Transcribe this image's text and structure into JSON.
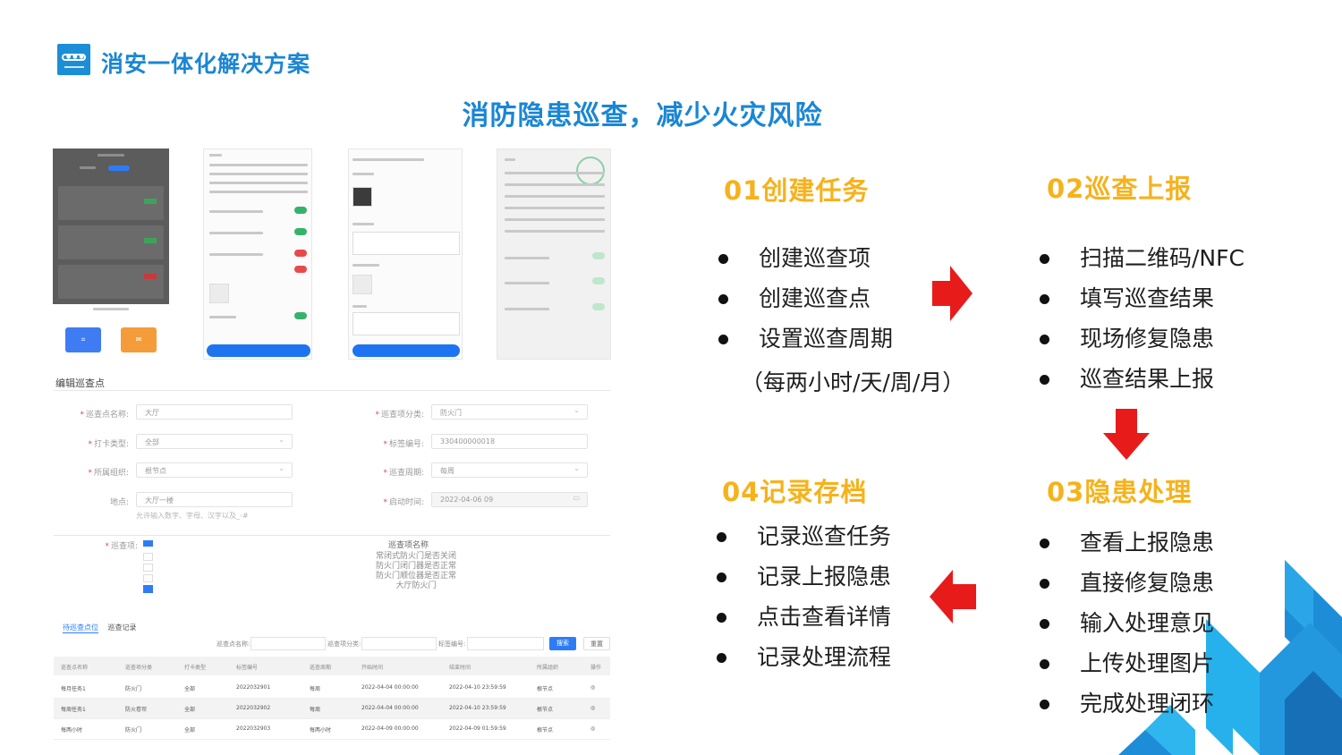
{
  "header": {
    "brand": "消安一体化解决方案",
    "headline": "消防隐患巡查，减少火灾风险"
  },
  "form": {
    "title": "编辑巡查点",
    "fields": [
      {
        "label": "巡查点名称:",
        "value": "大厅"
      },
      {
        "label": "巡查项分类:",
        "value": "防火门"
      },
      {
        "label": "打卡类型:",
        "value": "全部"
      },
      {
        "label": "标签编号:",
        "value": "330400000018"
      },
      {
        "label": "所属组织:",
        "value": "根节点"
      },
      {
        "label": "巡查周期:",
        "value": "每周"
      },
      {
        "label": "地点:",
        "value": "大厅一楼"
      },
      {
        "label": "启动时间:",
        "value": "2022-04-06 09"
      }
    ],
    "hint": "允许输入数字、字母、汉字以及_-#",
    "items_label": "巡查项:",
    "items_header": "巡查项名称",
    "items": [
      "常闭式防火门是否关闭",
      "防火门闭门器是否正常",
      "防火门顺位器是否正常",
      "大厅防火门"
    ]
  },
  "table": {
    "tabs": [
      "待巡查点位",
      "巡查记录"
    ],
    "search_labels": [
      "巡查点名称:",
      "巡查项分类:",
      "标签编号:"
    ],
    "search_button": "搜索",
    "reset_button": "重置",
    "columns": [
      "巡查点名称",
      "巡查项分类",
      "打卡类型",
      "标签编号",
      "巡查周期",
      "开始时间",
      "结束时间",
      "所属组织",
      "操作"
    ],
    "rows": [
      [
        "每月任务1",
        "防火门",
        "全部",
        "2022032901",
        "每周",
        "2022-04-04 00:00:00",
        "2022-04-10 23:59:59",
        "根节点",
        "◎"
      ],
      [
        "每周任务1",
        "防火卷帘",
        "全部",
        "2022032902",
        "每周",
        "2022-04-04 00:00:00",
        "2022-04-10 23:59:59",
        "根节点",
        "◎"
      ],
      [
        "每两小时",
        "防火门",
        "全部",
        "2022032903",
        "每两小时",
        "2022-04-09 00:00:00",
        "2022-04-09 01:59:59",
        "根节点",
        "◎"
      ]
    ]
  },
  "flow": {
    "step1": {
      "title": "01创建任务",
      "items": [
        "创建巡查项",
        "创建巡查点",
        "设置巡查周期"
      ],
      "note": "（每两小时/天/周/月）"
    },
    "step2": {
      "title": "02巡查上报",
      "items": [
        "扫描二维码/NFC",
        "填写巡查结果",
        "现场修复隐患",
        "巡查结果上报"
      ]
    },
    "step3": {
      "title": "03隐患处理",
      "items": [
        "查看上报隐患",
        "直接修复隐患",
        "输入处理意见",
        "上传处理图片",
        "完成处理闭环"
      ]
    },
    "step4": {
      "title": "04记录存档",
      "items": [
        "记录巡查任务",
        "记录上报隐患",
        "点击查看详情",
        "记录处理流程"
      ]
    }
  },
  "colors": {
    "brand_blue": "#1a86d4",
    "step_gold": "#f6b21c",
    "arrow_red": "#e81b1b"
  }
}
